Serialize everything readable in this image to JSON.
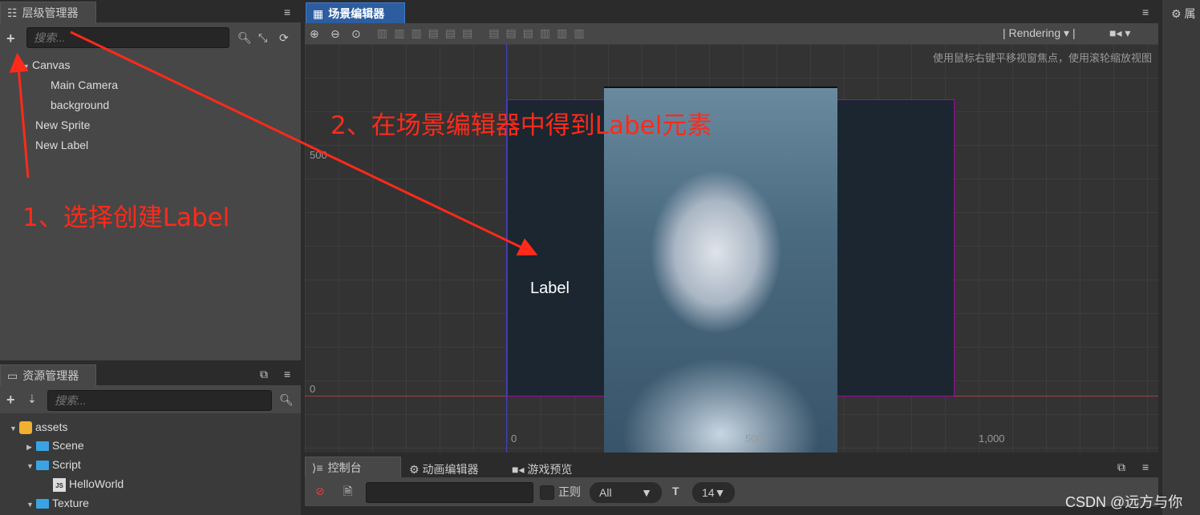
{
  "hierarchy": {
    "title": "层级管理器",
    "search_placeholder": "搜索...",
    "items": [
      {
        "label": "Canvas"
      },
      {
        "label": "Main Camera"
      },
      {
        "label": "background"
      },
      {
        "label": "New Sprite"
      },
      {
        "label": "New Label"
      }
    ]
  },
  "assets": {
    "title": "资源管理器",
    "search_placeholder": "搜索...",
    "items": [
      {
        "label": "assets"
      },
      {
        "label": "Scene"
      },
      {
        "label": "Script"
      },
      {
        "label": "HelloWorld"
      },
      {
        "label": "Texture"
      }
    ]
  },
  "scene": {
    "title": "场景编辑器",
    "rendering": "Rendering",
    "hint": "使用鼠标右键平移视窗焦点，使用滚轮缩放视图",
    "label_node": "Label",
    "y_ticks": [
      "500",
      "0"
    ],
    "x_ticks": [
      "0",
      "500",
      "1,000"
    ]
  },
  "inspector": {
    "title": "属"
  },
  "console": {
    "tabs": [
      "控制台",
      "动画编辑器",
      "游戏预览"
    ],
    "regex_label": "正则",
    "level": "All",
    "font_size": "14"
  },
  "annotations": {
    "step1": "1、选择创建Label",
    "step2": "2、在场景编辑器中得到Label元素"
  },
  "watermark": "CSDN @远方与你",
  "colors": {
    "accent": "#2d5d9f",
    "annotation": "#ff2a1a",
    "design_rect": "#b000b0"
  }
}
